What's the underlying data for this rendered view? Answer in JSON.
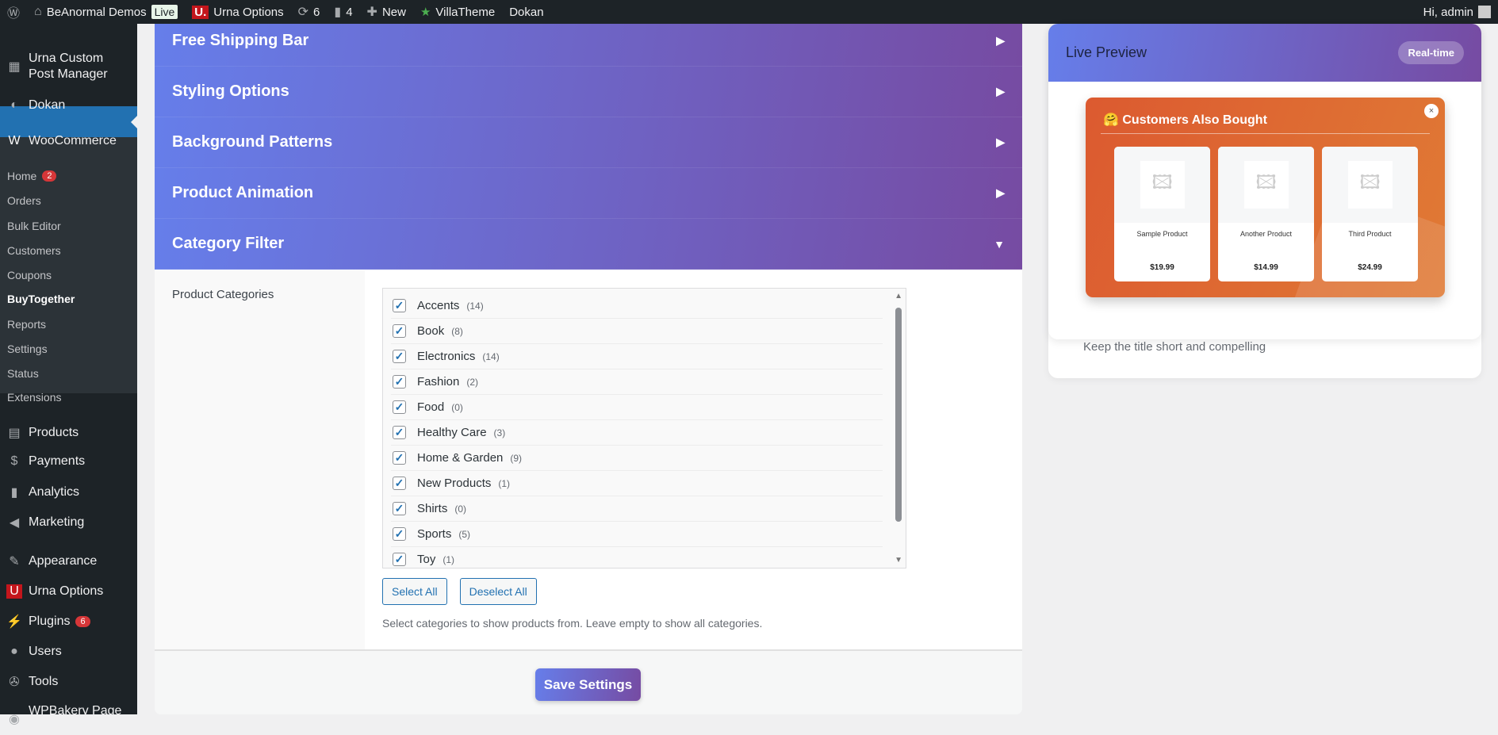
{
  "adminbar": {
    "site": "BeAnormal Demos",
    "live": "Live",
    "urna": "Urna Options",
    "updates": "6",
    "comments": "4",
    "new": "New",
    "villatheme": "VillaTheme",
    "dokan": "Dokan",
    "greeting": "Hi, admin"
  },
  "sidebar": {
    "items": [
      {
        "label": "Urna Custom Post Manager",
        "icon": "layout-icon"
      },
      {
        "label": "Dokan",
        "icon": "dokan-icon"
      },
      {
        "label": "WooCommerce",
        "icon": "woo-icon"
      },
      {
        "label": "Home",
        "badge": "2",
        "sub": true
      },
      {
        "label": "Orders",
        "sub": true
      },
      {
        "label": "Bulk Editor",
        "sub": true
      },
      {
        "label": "Customers",
        "sub": true
      },
      {
        "label": "Coupons",
        "sub": true
      },
      {
        "label": "BuyTogether",
        "sub": true,
        "current": true
      },
      {
        "label": "Reports",
        "sub": true
      },
      {
        "label": "Settings",
        "sub": true
      },
      {
        "label": "Status",
        "sub": true
      },
      {
        "label": "Extensions",
        "sub": true
      },
      {
        "label": "Products",
        "icon": "archive-icon"
      },
      {
        "label": "Payments",
        "icon": "dollar-icon"
      },
      {
        "label": "Analytics",
        "icon": "bar-chart-icon"
      },
      {
        "label": "Marketing",
        "icon": "megaphone-icon"
      },
      {
        "label": "Appearance",
        "icon": "brush-icon"
      },
      {
        "label": "Urna Options",
        "icon": "urna-icon"
      },
      {
        "label": "Plugins",
        "icon": "plugin-icon",
        "badge": "6"
      },
      {
        "label": "Users",
        "icon": "user-icon"
      },
      {
        "label": "Tools",
        "icon": "wrench-icon"
      },
      {
        "label": "WPBakery Page Builder",
        "icon": "wpbakery-icon"
      }
    ]
  },
  "sections": [
    "Free Shipping Bar",
    "Styling Options",
    "Background Patterns",
    "Product Animation",
    "Category Filter"
  ],
  "category_filter": {
    "label": "Product Categories",
    "categories": [
      {
        "name": "Accents",
        "count": "(14)",
        "checked": true
      },
      {
        "name": "Book",
        "count": "(8)",
        "checked": true
      },
      {
        "name": "Electronics",
        "count": "(14)",
        "checked": true
      },
      {
        "name": "Fashion",
        "count": "(2)",
        "checked": true
      },
      {
        "name": "Food",
        "count": "(0)",
        "checked": true
      },
      {
        "name": "Healthy Care",
        "count": "(3)",
        "checked": true
      },
      {
        "name": "Home & Garden",
        "count": "(9)",
        "checked": true
      },
      {
        "name": "New Products",
        "count": "(1)",
        "checked": true
      },
      {
        "name": "Shirts",
        "count": "(0)",
        "checked": true
      },
      {
        "name": "Sports",
        "count": "(5)",
        "checked": true
      },
      {
        "name": "Toy",
        "count": "(1)",
        "checked": true
      }
    ],
    "select_all": "Select All",
    "deselect_all": "Deselect All",
    "help": "Select categories to show products from. Leave empty to show all categories."
  },
  "save_label": "Save Settings",
  "preview": {
    "title": "Live Preview",
    "badge": "Real-time",
    "popup_title": "Customers Also Bought",
    "close": "×",
    "products": [
      {
        "name": "Sample Product",
        "price": "$19.99"
      },
      {
        "name": "Another Product",
        "price": "$14.99"
      },
      {
        "name": "Third Product",
        "price": "$24.99"
      }
    ],
    "hint": "Keep the title short and compelling"
  }
}
